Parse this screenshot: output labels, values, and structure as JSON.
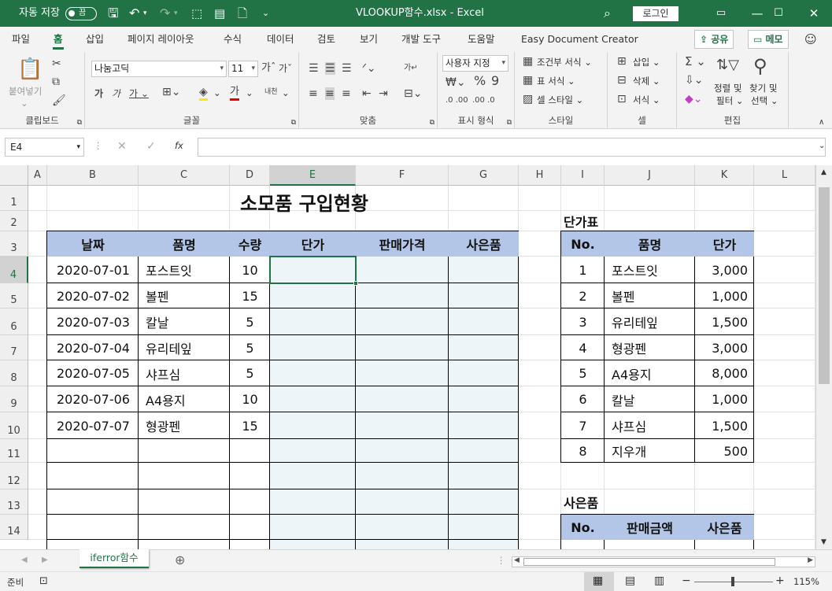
{
  "titlebar": {
    "autosave_label": "자동 저장",
    "autosave_state": "끔",
    "file_title": "VLOOKUP함수.xlsx  -  Excel",
    "login": "로그인"
  },
  "menu": {
    "tabs": [
      "파일",
      "홈",
      "삽입",
      "페이지 레이아웃",
      "수식",
      "데이터",
      "검토",
      "보기",
      "개발 도구",
      "도움말",
      "Easy Document Creator"
    ],
    "share": "공유",
    "memo": "메모"
  },
  "ribbon": {
    "clipboard": {
      "paste": "붙여넣기",
      "label": "클립보드"
    },
    "font": {
      "name": "나눔고딕",
      "size": "11",
      "label": "글꼴"
    },
    "align": {
      "label": "맞춤"
    },
    "number": {
      "format": "사용자 지정",
      "label": "표시 형식"
    },
    "style": {
      "conditional": "조건부 서식",
      "table": "표 서식",
      "cell": "셀 스타일",
      "label": "스타일"
    },
    "cells": {
      "insert": "삽입",
      "delete": "삭제",
      "format": "서식",
      "label": "셀"
    },
    "edit": {
      "sort": "정렬 및",
      "filter": "필터",
      "find": "찾기 및",
      "select": "선택",
      "label": "편집"
    }
  },
  "formula": {
    "namebox": "E4",
    "fx": "fx",
    "value": ""
  },
  "columns": [
    "A",
    "B",
    "C",
    "D",
    "E",
    "F",
    "G",
    "H",
    "I",
    "J",
    "K",
    "L"
  ],
  "rows": [
    "1",
    "2",
    "3",
    "4",
    "5",
    "6",
    "7",
    "8",
    "9",
    "10",
    "11",
    "12",
    "13",
    "14"
  ],
  "sheet": {
    "title": "소모품 구입현황",
    "main_headers": [
      "날짜",
      "품명",
      "수량",
      "단가",
      "판매가격",
      "사은품"
    ],
    "main_rows": [
      [
        "2020-07-01",
        "포스트잇",
        "10"
      ],
      [
        "2020-07-02",
        "볼펜",
        "15"
      ],
      [
        "2020-07-03",
        "칼날",
        "5"
      ],
      [
        "2020-07-04",
        "유리테잎",
        "5"
      ],
      [
        "2020-07-05",
        "샤프심",
        "5"
      ],
      [
        "2020-07-06",
        "A4용지",
        "10"
      ],
      [
        "2020-07-07",
        "형광펜",
        "15"
      ]
    ],
    "price_title": "단가표",
    "price_headers": [
      "No.",
      "품명",
      "단가"
    ],
    "price_rows": [
      [
        "1",
        "포스트잇",
        "3,000"
      ],
      [
        "2",
        "볼펜",
        "1,000"
      ],
      [
        "3",
        "유리테잎",
        "1,500"
      ],
      [
        "4",
        "형광펜",
        "3,000"
      ],
      [
        "5",
        "A4용지",
        "8,000"
      ],
      [
        "6",
        "칼날",
        "1,000"
      ],
      [
        "7",
        "샤프심",
        "1,500"
      ],
      [
        "8",
        "지우개",
        "500"
      ]
    ],
    "gift_title": "사은품",
    "gift_headers": [
      "No.",
      "판매금액",
      "사은품"
    ]
  },
  "sheettab": "iferror함수",
  "status": {
    "ready": "준비",
    "zoom": "115%"
  }
}
